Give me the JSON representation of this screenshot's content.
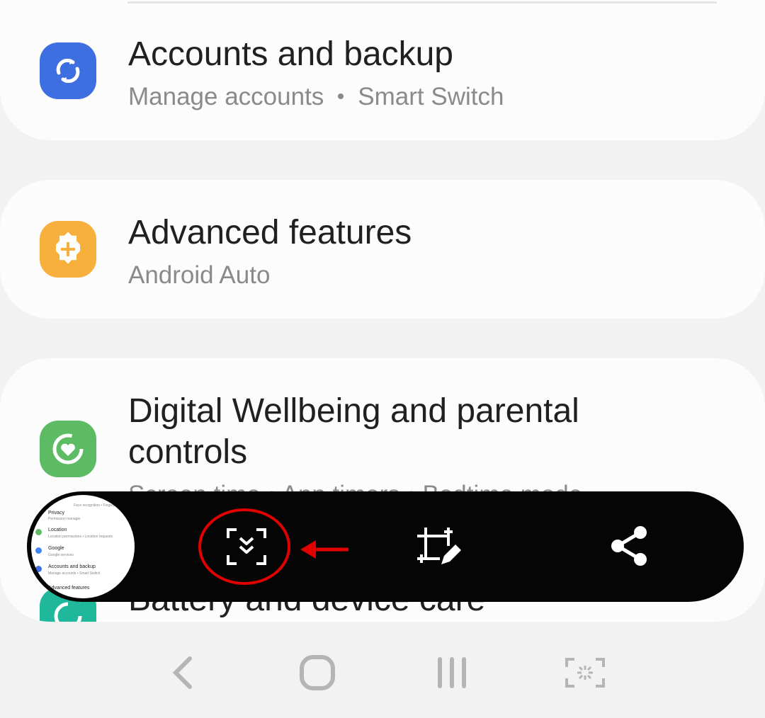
{
  "settings": {
    "items": [
      {
        "title": "Accounts and backup",
        "subtitle_parts": [
          "Manage accounts",
          "Smart Switch"
        ],
        "icon": "sync-icon",
        "color": "#3d6fe0"
      },
      {
        "title": "Advanced features",
        "subtitle": "Android Auto",
        "icon": "gear-plus-icon",
        "color": "#f8b03c"
      },
      {
        "title_line1": "Digital Wellbeing and parental",
        "title_line2": "controls",
        "subtitle_partial": "Screen time  •  App timers  •  Bedtime mode",
        "icon": "wellbeing-heart-icon",
        "color": "#5dbb63"
      },
      {
        "title": "Battery and device care",
        "icon": "device-care-icon",
        "color": "#1fb89a"
      }
    ]
  },
  "thumbnail": {
    "rows": [
      {
        "label": "Privacy",
        "sub": "Permission manager"
      },
      {
        "label": "Location",
        "sub": "Location permissions  •  Location requests"
      },
      {
        "label": "Google",
        "sub": "Google services"
      },
      {
        "label": "Accounts and backup",
        "sub": "Manage accounts  •  Smart Switch"
      },
      {
        "label": "Advanced features",
        "sub": ""
      }
    ],
    "top_text": "Face recognition  •  Fingerprints"
  },
  "toolbar": {
    "buttons": [
      "scroll-capture-icon",
      "crop-edit-icon",
      "share-icon"
    ],
    "highlight_color": "#e00000"
  },
  "navbar": {
    "buttons": [
      "back-icon",
      "home-icon",
      "recents-icon",
      "screenshot-icon"
    ]
  }
}
